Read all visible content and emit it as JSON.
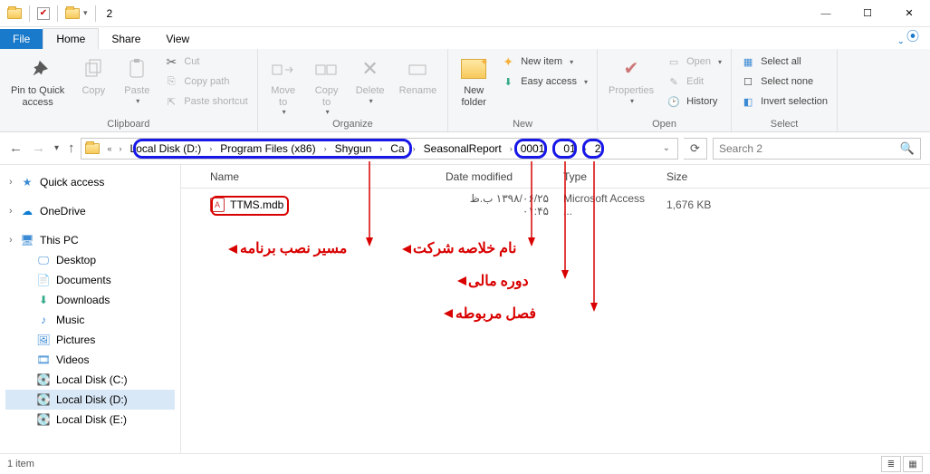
{
  "window": {
    "title": "2"
  },
  "tabs": {
    "file": "File",
    "home": "Home",
    "share": "Share",
    "view": "View"
  },
  "ribbon": {
    "pin": "Pin to Quick\naccess",
    "copy": "Copy",
    "paste": "Paste",
    "cut": "Cut",
    "copypath": "Copy path",
    "pasteshortcut": "Paste shortcut",
    "clipboard": "Clipboard",
    "moveto": "Move\nto",
    "copyto": "Copy\nto",
    "delete": "Delete",
    "rename": "Rename",
    "organize": "Organize",
    "newfolder": "New\nfolder",
    "newitem": "New item",
    "easyaccess": "Easy access",
    "new": "New",
    "properties": "Properties",
    "open": "Open",
    "edit": "Edit",
    "history": "History",
    "open_g": "Open",
    "selectall": "Select all",
    "selectnone": "Select none",
    "invert": "Invert selection",
    "select": "Select"
  },
  "breadcrumb": {
    "items": [
      "Local Disk (D:)",
      "Program Files (x86)",
      "Shygun",
      "Ca",
      "SeasonalReport",
      "0001",
      "01",
      "2"
    ]
  },
  "search": {
    "placeholder": "Search 2"
  },
  "columns": {
    "name": "Name",
    "date": "Date modified",
    "type": "Type",
    "size": "Size"
  },
  "file": {
    "name": "TTMS.mdb",
    "date": "۱۳۹۸/۰۶/۲۵ ب.ظ ۰۱:۴۵",
    "type": "Microsoft Access ...",
    "size": "1,676 KB"
  },
  "sidebar": {
    "quick": "Quick access",
    "onedrive": "OneDrive",
    "thispc": "This PC",
    "desktop": "Desktop",
    "documents": "Documents",
    "downloads": "Downloads",
    "music": "Music",
    "pictures": "Pictures",
    "videos": "Videos",
    "diskc": "Local Disk (C:)",
    "diskd": "Local Disk (D:)",
    "diske": "Local Disk (E:)"
  },
  "status": {
    "count": "1 item"
  },
  "annotations": {
    "install_path": "مسیر نصب برنامه",
    "company": "نام خلاصه شرکت",
    "period": "دوره مالی",
    "season": "فصل مربوطه"
  }
}
